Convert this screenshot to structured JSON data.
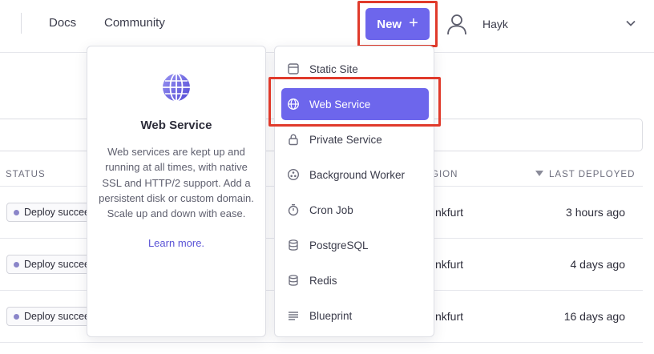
{
  "nav": {
    "docs": "Docs",
    "community": "Community",
    "new_button": "New",
    "new_plus": "+",
    "user_name": "Hayk"
  },
  "table": {
    "headers": {
      "status": "STATUS",
      "region": "GION",
      "last_deployed": "LAST DEPLOYED"
    },
    "rows": [
      {
        "status": "Deploy succeeded",
        "region": "nkfurt",
        "last_deployed": "3 hours ago"
      },
      {
        "status": "Deploy succeeded",
        "region": "nkfurt",
        "last_deployed": "4 days ago"
      },
      {
        "status": "Deploy succeeded",
        "region": "nkfurt",
        "last_deployed": "16 days ago"
      }
    ]
  },
  "description": {
    "title": "Web Service",
    "body": "Web services are kept up and running at all times, with native SSL and HTTP/2 support. Add a persistent disk or custom domain. Scale up and down with ease.",
    "link": "Learn more."
  },
  "menu": {
    "items": [
      {
        "label": "Static Site",
        "icon": "static-site-icon"
      },
      {
        "label": "Web Service",
        "icon": "globe-icon"
      },
      {
        "label": "Private Service",
        "icon": "lock-icon"
      },
      {
        "label": "Background Worker",
        "icon": "worker-icon"
      },
      {
        "label": "Cron Job",
        "icon": "stopwatch-icon"
      },
      {
        "label": "PostgreSQL",
        "icon": "database-icon"
      },
      {
        "label": "Redis",
        "icon": "database-icon"
      },
      {
        "label": "Blueprint",
        "icon": "blueprint-icon"
      }
    ],
    "selected": "Web Service"
  },
  "colors": {
    "accent": "#6d66ec",
    "highlight_box": "#e03a2b",
    "link": "#5a53d6",
    "status_dot": "#8a85c9"
  }
}
